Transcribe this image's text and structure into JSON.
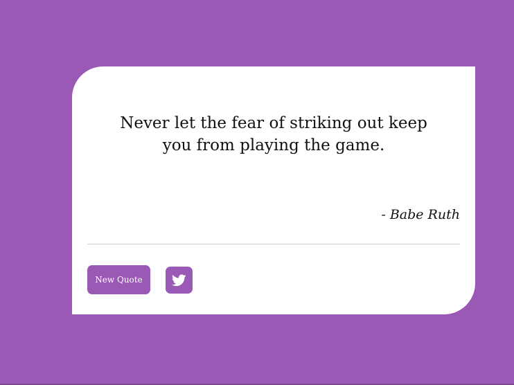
{
  "colors": {
    "background": "#9b59b6",
    "card": "#ffffff",
    "text": "#111111",
    "button": "#9b59b6",
    "button_text": "#ffffff"
  },
  "quote_box": {
    "text": "Never let the fear of striking out keep you from playing the game.",
    "author": "- Babe Ruth"
  },
  "actions": {
    "new_quote_label": "New Quote",
    "tweet_icon": "twitter-icon"
  }
}
